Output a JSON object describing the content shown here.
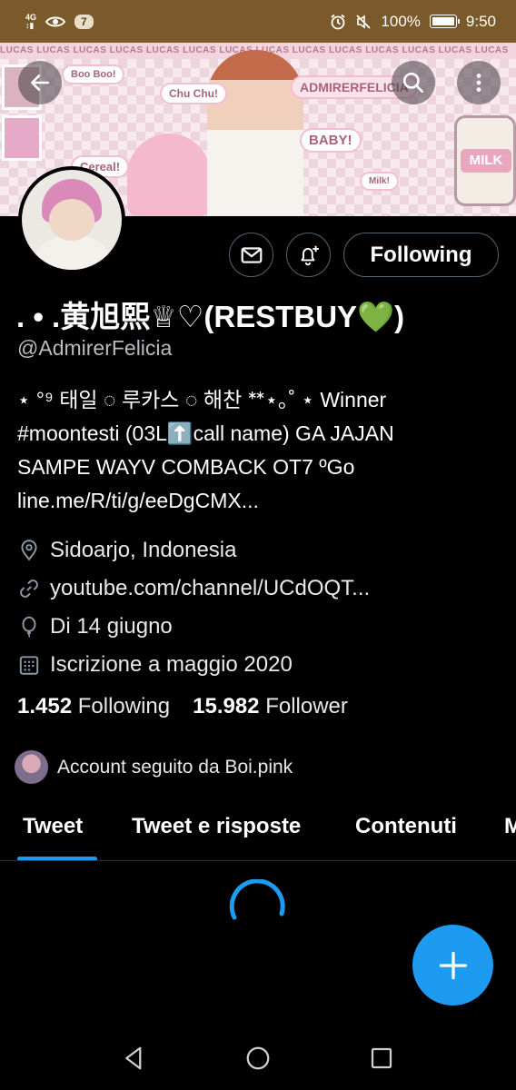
{
  "status_bar": {
    "network": "4G",
    "notification_count": "7",
    "battery": "100%",
    "time": "9:50"
  },
  "banner": {
    "strip_text": "LUCAS LUCAS LUCAS LUCAS LUCAS LUCAS LUCAS LUCAS LUCAS LUCAS LUCAS LUCAS LUCAS LUCAS",
    "stickers": [
      "Boo Boo!",
      "Chu Chu!",
      "Cereal!",
      "BABY!",
      "Milk!",
      "ADMIRERFELICIA",
      "MILK",
      "LUCAS"
    ]
  },
  "profile": {
    "display_name": ". • .黄旭熙♕♡(RESTBUY💚)",
    "handle": "@AdmirerFelicia",
    "follow_label": "Following",
    "bio_lines": [
      "⋆ °⁹ 태일 ◌ 루카스 ◌ 해찬 ᕯ⋆｡˚ ⋆   Winner",
      "#moontesti  (03L⬆️call name) GA JAJAN",
      "SAMPE WAYV COMBACK OT7 ºGo",
      "line.me/R/ti/g/eeDgCMX..."
    ],
    "location": "Sidoarjo, Indonesia",
    "website": "youtube.com/channel/UCdOQT...",
    "birthday": "Di 14 giugno",
    "joined": "Iscrizione a maggio 2020",
    "following_count": "1.452",
    "following_label": "Following",
    "followers_count": "15.982",
    "followers_label": "Follower",
    "followed_by": "Account seguito da Boi.pink"
  },
  "tabs": [
    {
      "label": "Tweet",
      "active": true
    },
    {
      "label": "Tweet e risposte",
      "active": false
    },
    {
      "label": "Contenuti",
      "active": false
    },
    {
      "label": "Mi piace",
      "active": false
    }
  ],
  "colors": {
    "accent": "#1d9bf0",
    "background": "#000000",
    "status_bar": "#7a5a2a",
    "border": "#536471"
  },
  "icons": [
    "back-arrow-icon",
    "search-icon",
    "more-vertical-icon",
    "mail-icon",
    "bell-plus-icon",
    "location-pin-icon",
    "link-icon",
    "balloon-icon",
    "calendar-icon",
    "plus-icon",
    "back-triangle-icon",
    "home-circle-icon",
    "recents-square-icon"
  ]
}
